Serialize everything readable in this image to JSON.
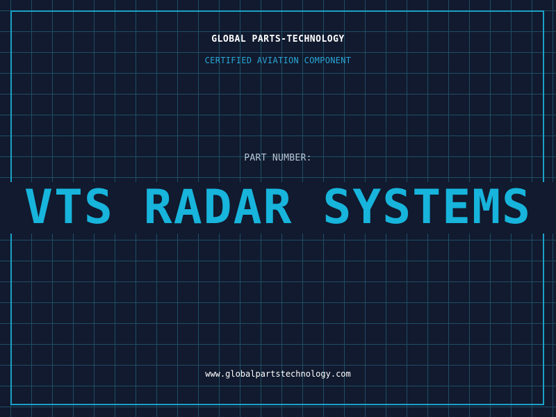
{
  "header": {
    "company": "GLOBAL PARTS-TECHNOLOGY",
    "tagline": "CERTIFIED AVIATION COMPONENT"
  },
  "part": {
    "label": "PART NUMBER:",
    "value": "VTS RADAR SYSTEMS"
  },
  "footer": {
    "url": "www.globalpartstechnology.com"
  },
  "colors": {
    "background": "#111a2e",
    "grid": "#1f4e66",
    "accent": "#1aa2c8",
    "part_value": "#17b4dc"
  }
}
